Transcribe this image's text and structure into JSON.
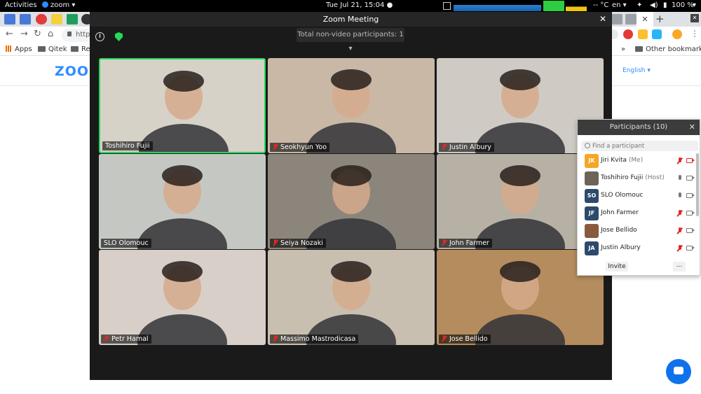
{
  "topbar": {
    "activities": "Activities",
    "app_name": "zoom",
    "clock": "Tue Jul 21, 15:04",
    "temp": "-- °C",
    "lang": "en",
    "battery": "100 %"
  },
  "browser": {
    "url_prefix": "https",
    "bookmarks": [
      {
        "label": "Apps"
      },
      {
        "label": "Qitek"
      },
      {
        "label": "Res"
      }
    ],
    "bookmarks_overflow": "»",
    "other_bookmarks": "Other bookmarks"
  },
  "webpage": {
    "logo_text": "zoom",
    "language": "English"
  },
  "zoom": {
    "title": "Zoom Meeting",
    "nonvideo_label": "Total non-video participants: 1",
    "tiles": [
      {
        "name": "Toshihiro Fujii",
        "muted": false,
        "active": true,
        "bg": "#d7d2c8"
      },
      {
        "name": "Seokhyun Yoo",
        "muted": true,
        "active": false,
        "bg": "#c9b8a6"
      },
      {
        "name": "Justin Albury",
        "muted": true,
        "active": false,
        "bg": "#cfcbc4"
      },
      {
        "name": "SLO Olomouc",
        "muted": false,
        "active": false,
        "bg": "#c5c8c2"
      },
      {
        "name": "Seiya Nozaki",
        "muted": true,
        "active": false,
        "bg": "#8c857b"
      },
      {
        "name": "John Farmer",
        "muted": true,
        "active": false,
        "bg": "#b7b1a5"
      },
      {
        "name": "Petr Hamal",
        "muted": true,
        "active": false,
        "bg": "#d8cfc8"
      },
      {
        "name": "Massimo Mastrodicasa",
        "muted": true,
        "active": false,
        "bg": "#c9bfb0"
      },
      {
        "name": "Jose Bellido",
        "muted": true,
        "active": false,
        "bg": "#b58c5e"
      }
    ]
  },
  "participants": {
    "title": "Participants (10)",
    "search_placeholder": "Find a participant",
    "rows": [
      {
        "initials": "JK",
        "name": "Jiri Kvita",
        "tag": "(Me)",
        "color": "#f5a623",
        "mic_muted": true,
        "cam_off": true
      },
      {
        "initials": "",
        "name": "Toshihiro Fujii",
        "tag": "(Host)",
        "color": "#6d6359",
        "mic_muted": false,
        "cam_off": false
      },
      {
        "initials": "SO",
        "name": "SLO Olomouc",
        "tag": "",
        "color": "#2c4a6b",
        "mic_muted": false,
        "cam_off": false
      },
      {
        "initials": "JF",
        "name": "John Farmer",
        "tag": "",
        "color": "#2c4a6b",
        "mic_muted": true,
        "cam_off": false
      },
      {
        "initials": "",
        "name": "Jose Bellido",
        "tag": "",
        "color": "#8a5a3c",
        "mic_muted": true,
        "cam_off": false
      },
      {
        "initials": "JA",
        "name": "Justin Albury",
        "tag": "",
        "color": "#2c4a6b",
        "mic_muted": true,
        "cam_off": false
      }
    ],
    "invite_label": "Invite",
    "more_label": "..."
  }
}
